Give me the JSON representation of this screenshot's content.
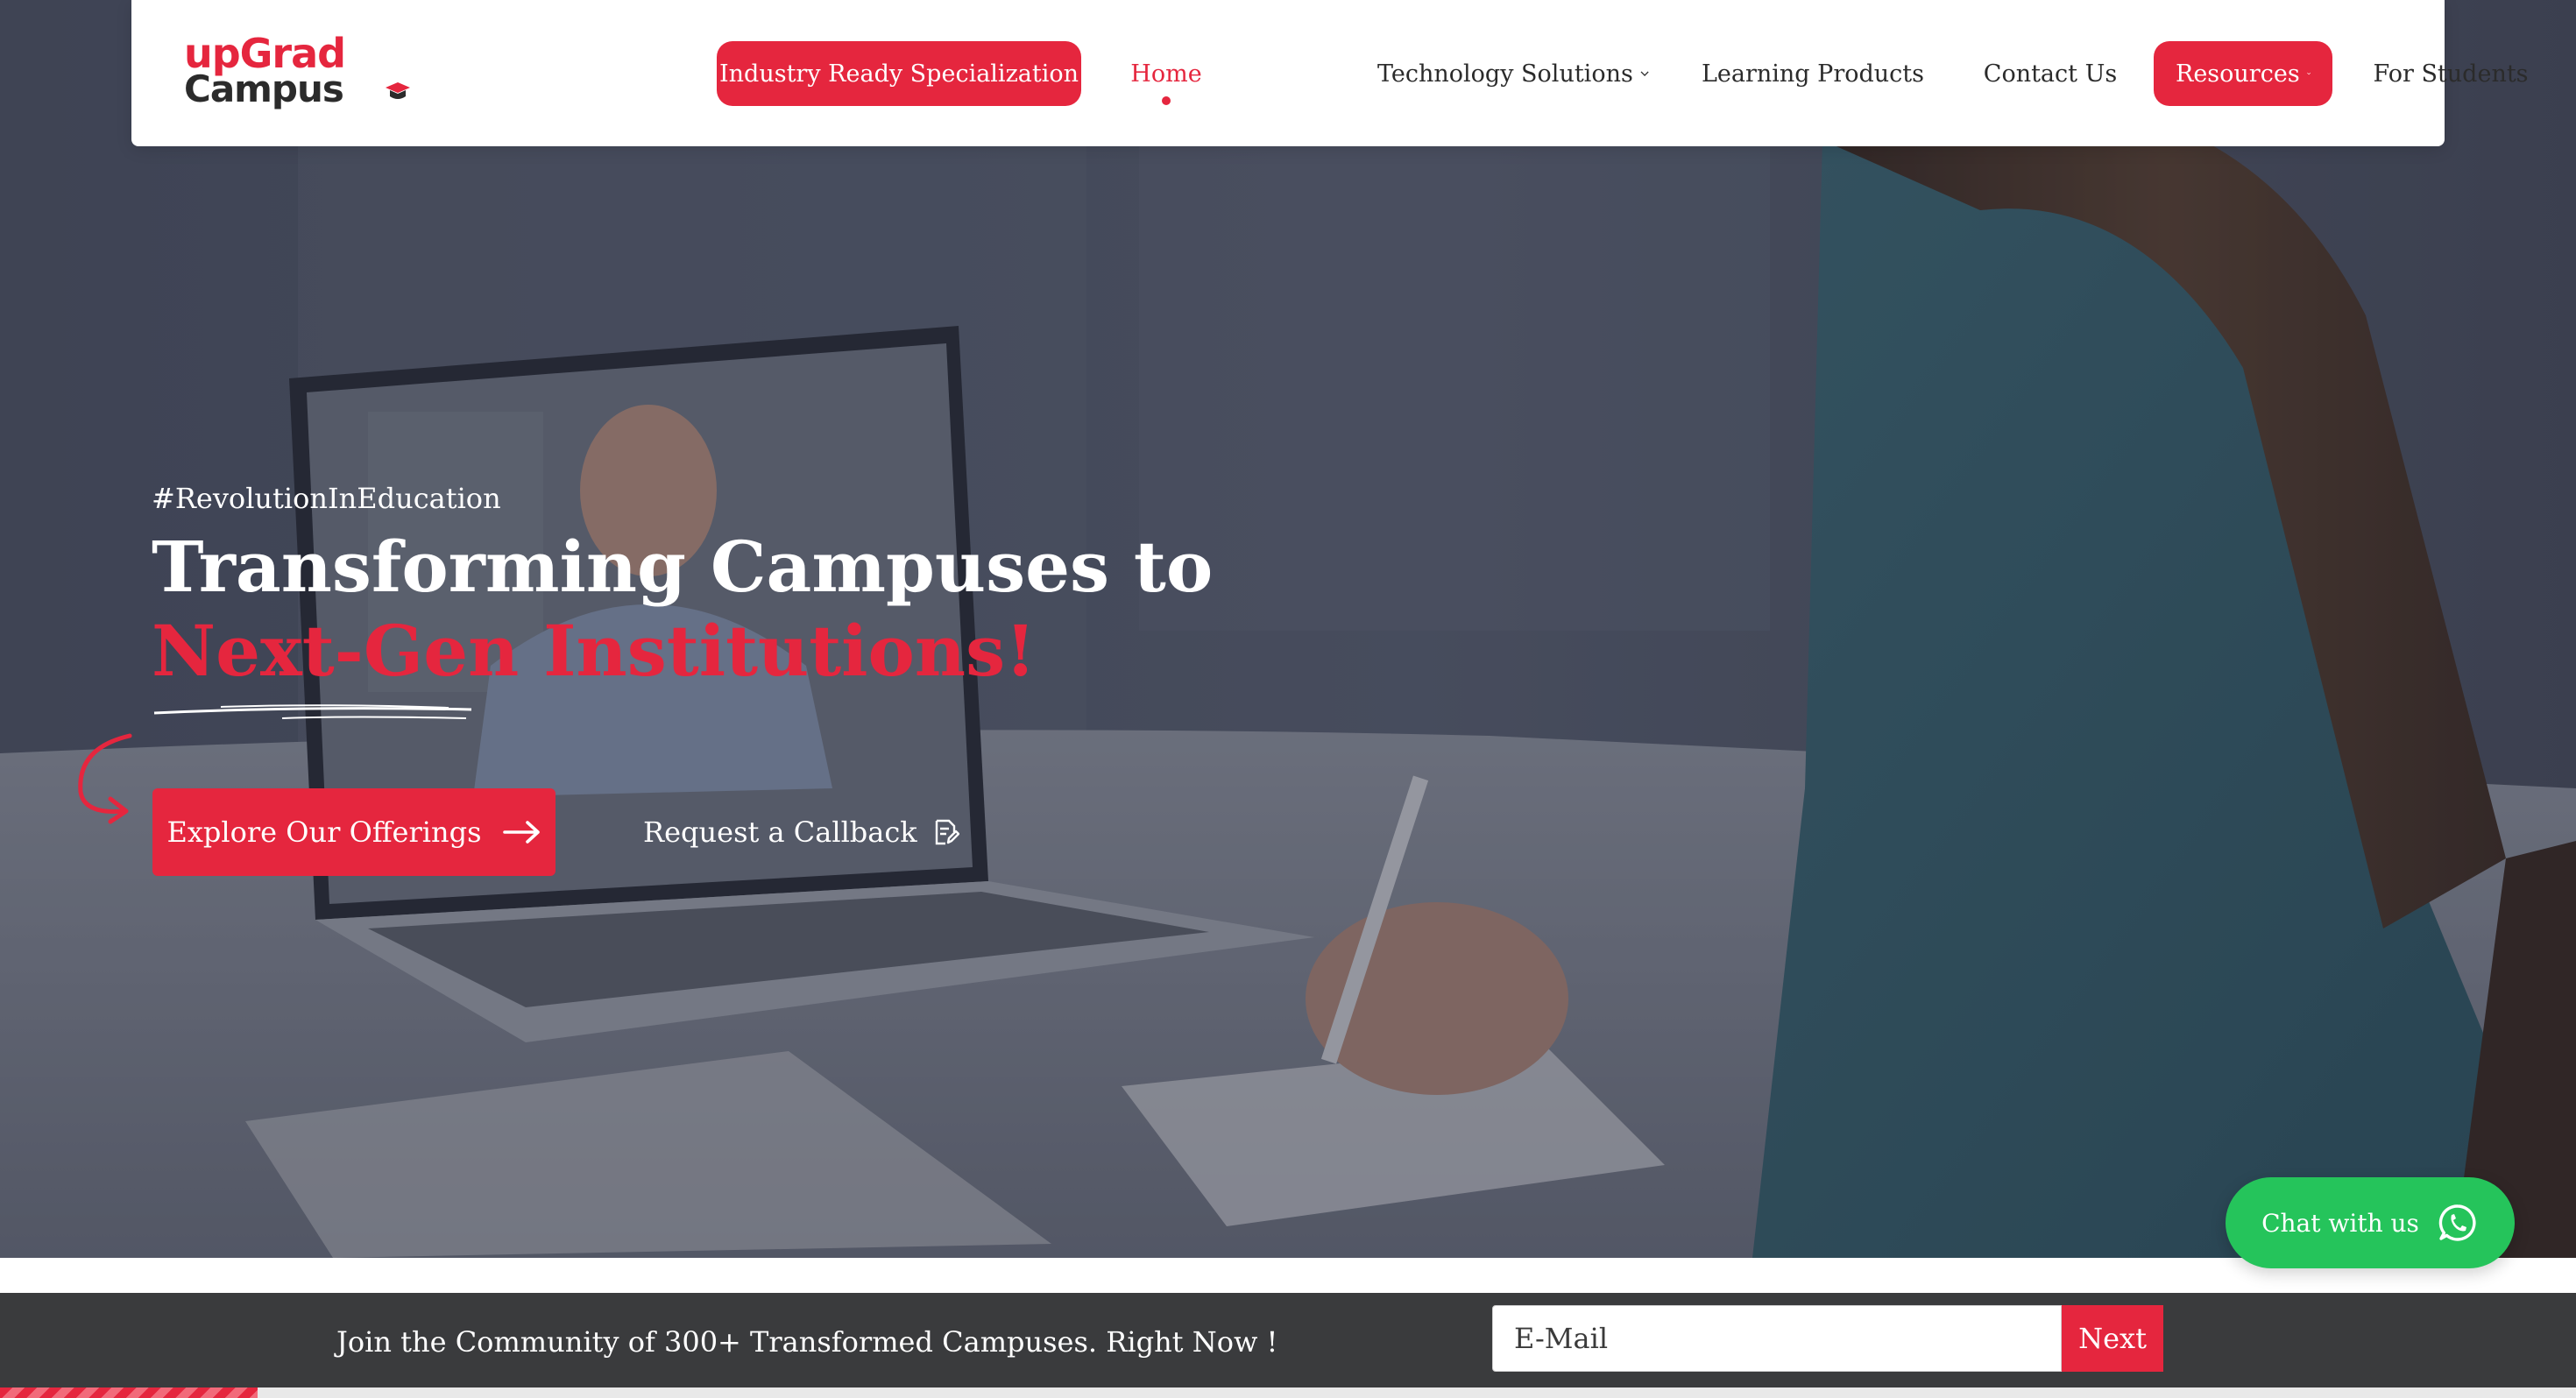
{
  "brand": {
    "logo_line1": "upGrad",
    "logo_line2": "Campus",
    "accent_color": "#e5263e",
    "chat_color": "#25c45b"
  },
  "nav": {
    "items": [
      {
        "label": "Industry Ready Specialization",
        "style": "pill"
      },
      {
        "label": "Home",
        "style": "active"
      },
      {
        "label": "Technology Solutions",
        "dropdown": true
      },
      {
        "label": "Learning Products",
        "dropdown": true
      },
      {
        "label": "Contact Us"
      },
      {
        "label": "Resources",
        "style": "pill",
        "dropdown": true
      },
      {
        "label": "For Students"
      }
    ]
  },
  "hero": {
    "hashtag": "#RevolutionInEducation",
    "title_line1": "Transforming Campuses to",
    "title_line2": "Next-Gen Institutions!",
    "primary_button": "Explore Our Offerings",
    "secondary_button": "Request a Callback"
  },
  "chat": {
    "label": "Chat with us",
    "icon": "whatsapp-icon"
  },
  "community_bar": {
    "message": "Join the Community of 300+ Transformed Campuses. Right Now !",
    "email_placeholder": "E-Mail",
    "submit_label": "Next"
  }
}
